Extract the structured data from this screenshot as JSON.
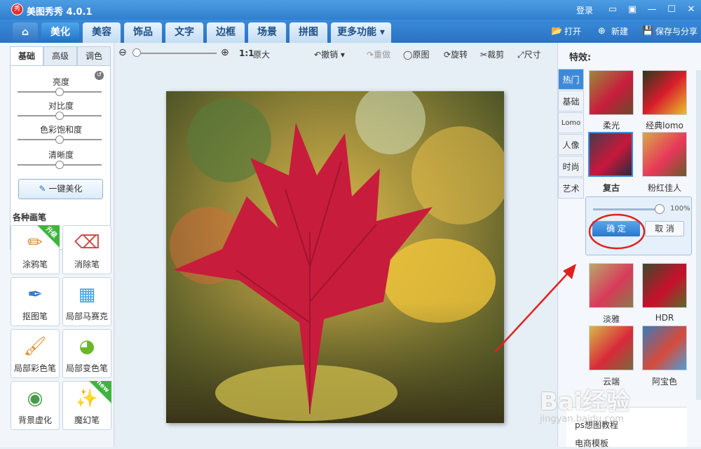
{
  "app": {
    "title": "美图秀秀 4.0.1",
    "login": "登录",
    "logo_char": "秀"
  },
  "tabs": [
    {
      "label": "美化",
      "active": true
    },
    {
      "label": "美容"
    },
    {
      "label": "饰品"
    },
    {
      "label": "文字"
    },
    {
      "label": "边框"
    },
    {
      "label": "场景"
    },
    {
      "label": "拼图"
    },
    {
      "label": "更多功能 ▾"
    }
  ],
  "toolbar_right": {
    "open": "打开",
    "new": "新建",
    "save_share": "保存与分享"
  },
  "left_panel": {
    "tabs": [
      "基础",
      "高级",
      "调色"
    ],
    "sliders": [
      {
        "label": "亮度",
        "value": 0.5
      },
      {
        "label": "对比度",
        "value": 0.5
      },
      {
        "label": "色彩饱和度",
        "value": 0.5
      },
      {
        "label": "清晰度",
        "value": 0.5
      }
    ],
    "one_key": "一键美化",
    "brushes_title": "各种画笔",
    "brushes": [
      {
        "label": "涂鸦笔",
        "badge": "升级"
      },
      {
        "label": "消除笔"
      },
      {
        "label": "抠图笔"
      },
      {
        "label": "局部马赛克"
      },
      {
        "label": "局部彩色笔"
      },
      {
        "label": "局部变色笔"
      },
      {
        "label": "背景虚化"
      },
      {
        "label": "魔幻笔",
        "badge": "new"
      }
    ]
  },
  "zoom": {
    "ratio": "1:1",
    "original_size": "原大",
    "undo": "撤销",
    "redo": "重做",
    "original": "原图",
    "rotate": "旋转",
    "crop": "裁剪",
    "size": "尺寸"
  },
  "effects": {
    "title": "特效:",
    "categories": [
      "热门",
      "基础",
      "Lomo",
      "人像",
      "时尚",
      "艺术"
    ],
    "active_category": "热门",
    "items": [
      "柔光",
      "经典lomo",
      "复古",
      "粉红佳人",
      "淡雅",
      "HDR",
      "云端",
      "阿宝色"
    ],
    "selected": "复古",
    "strength": "100%",
    "ok": "确 定",
    "cancel": "取 消"
  },
  "bottom_links": [
    "ps想图教程",
    "电商模板"
  ],
  "watermark": {
    "main": "Bai经验",
    "sub": "jingyan.baidu.com"
  }
}
